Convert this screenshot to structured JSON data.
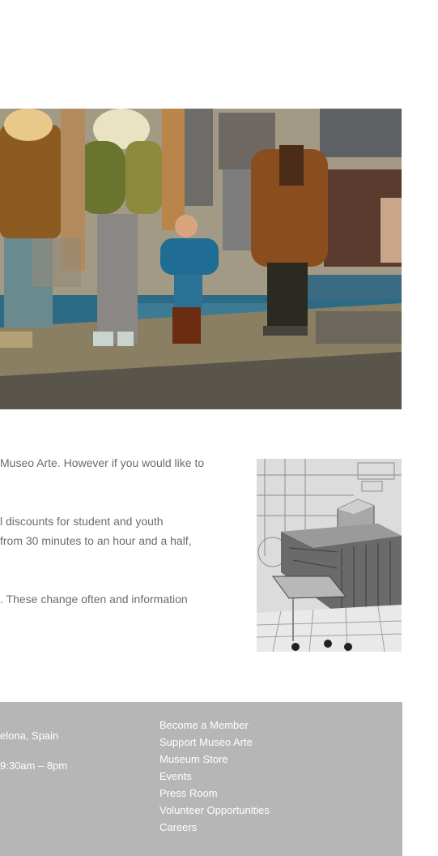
{
  "content": {
    "paragraph_lines": [
      "Museo Arte. However if you would like to",
      "l discounts for student and youth",
      "from 30 minutes to an hour and a half,",
      ". These change often and information"
    ]
  },
  "footer": {
    "address_line": "elona, Spain",
    "hours_line": "9:30am – 8pm",
    "links": [
      "Become a Member",
      "Support Museo Arte",
      "Museum Store",
      "Events",
      "Press Room",
      "Volunteer Opportunities",
      "Careers"
    ]
  },
  "colors": {
    "footer_background": "#b6b6b6",
    "body_text": "#6b6b6b",
    "footer_text": "#ffffff"
  }
}
